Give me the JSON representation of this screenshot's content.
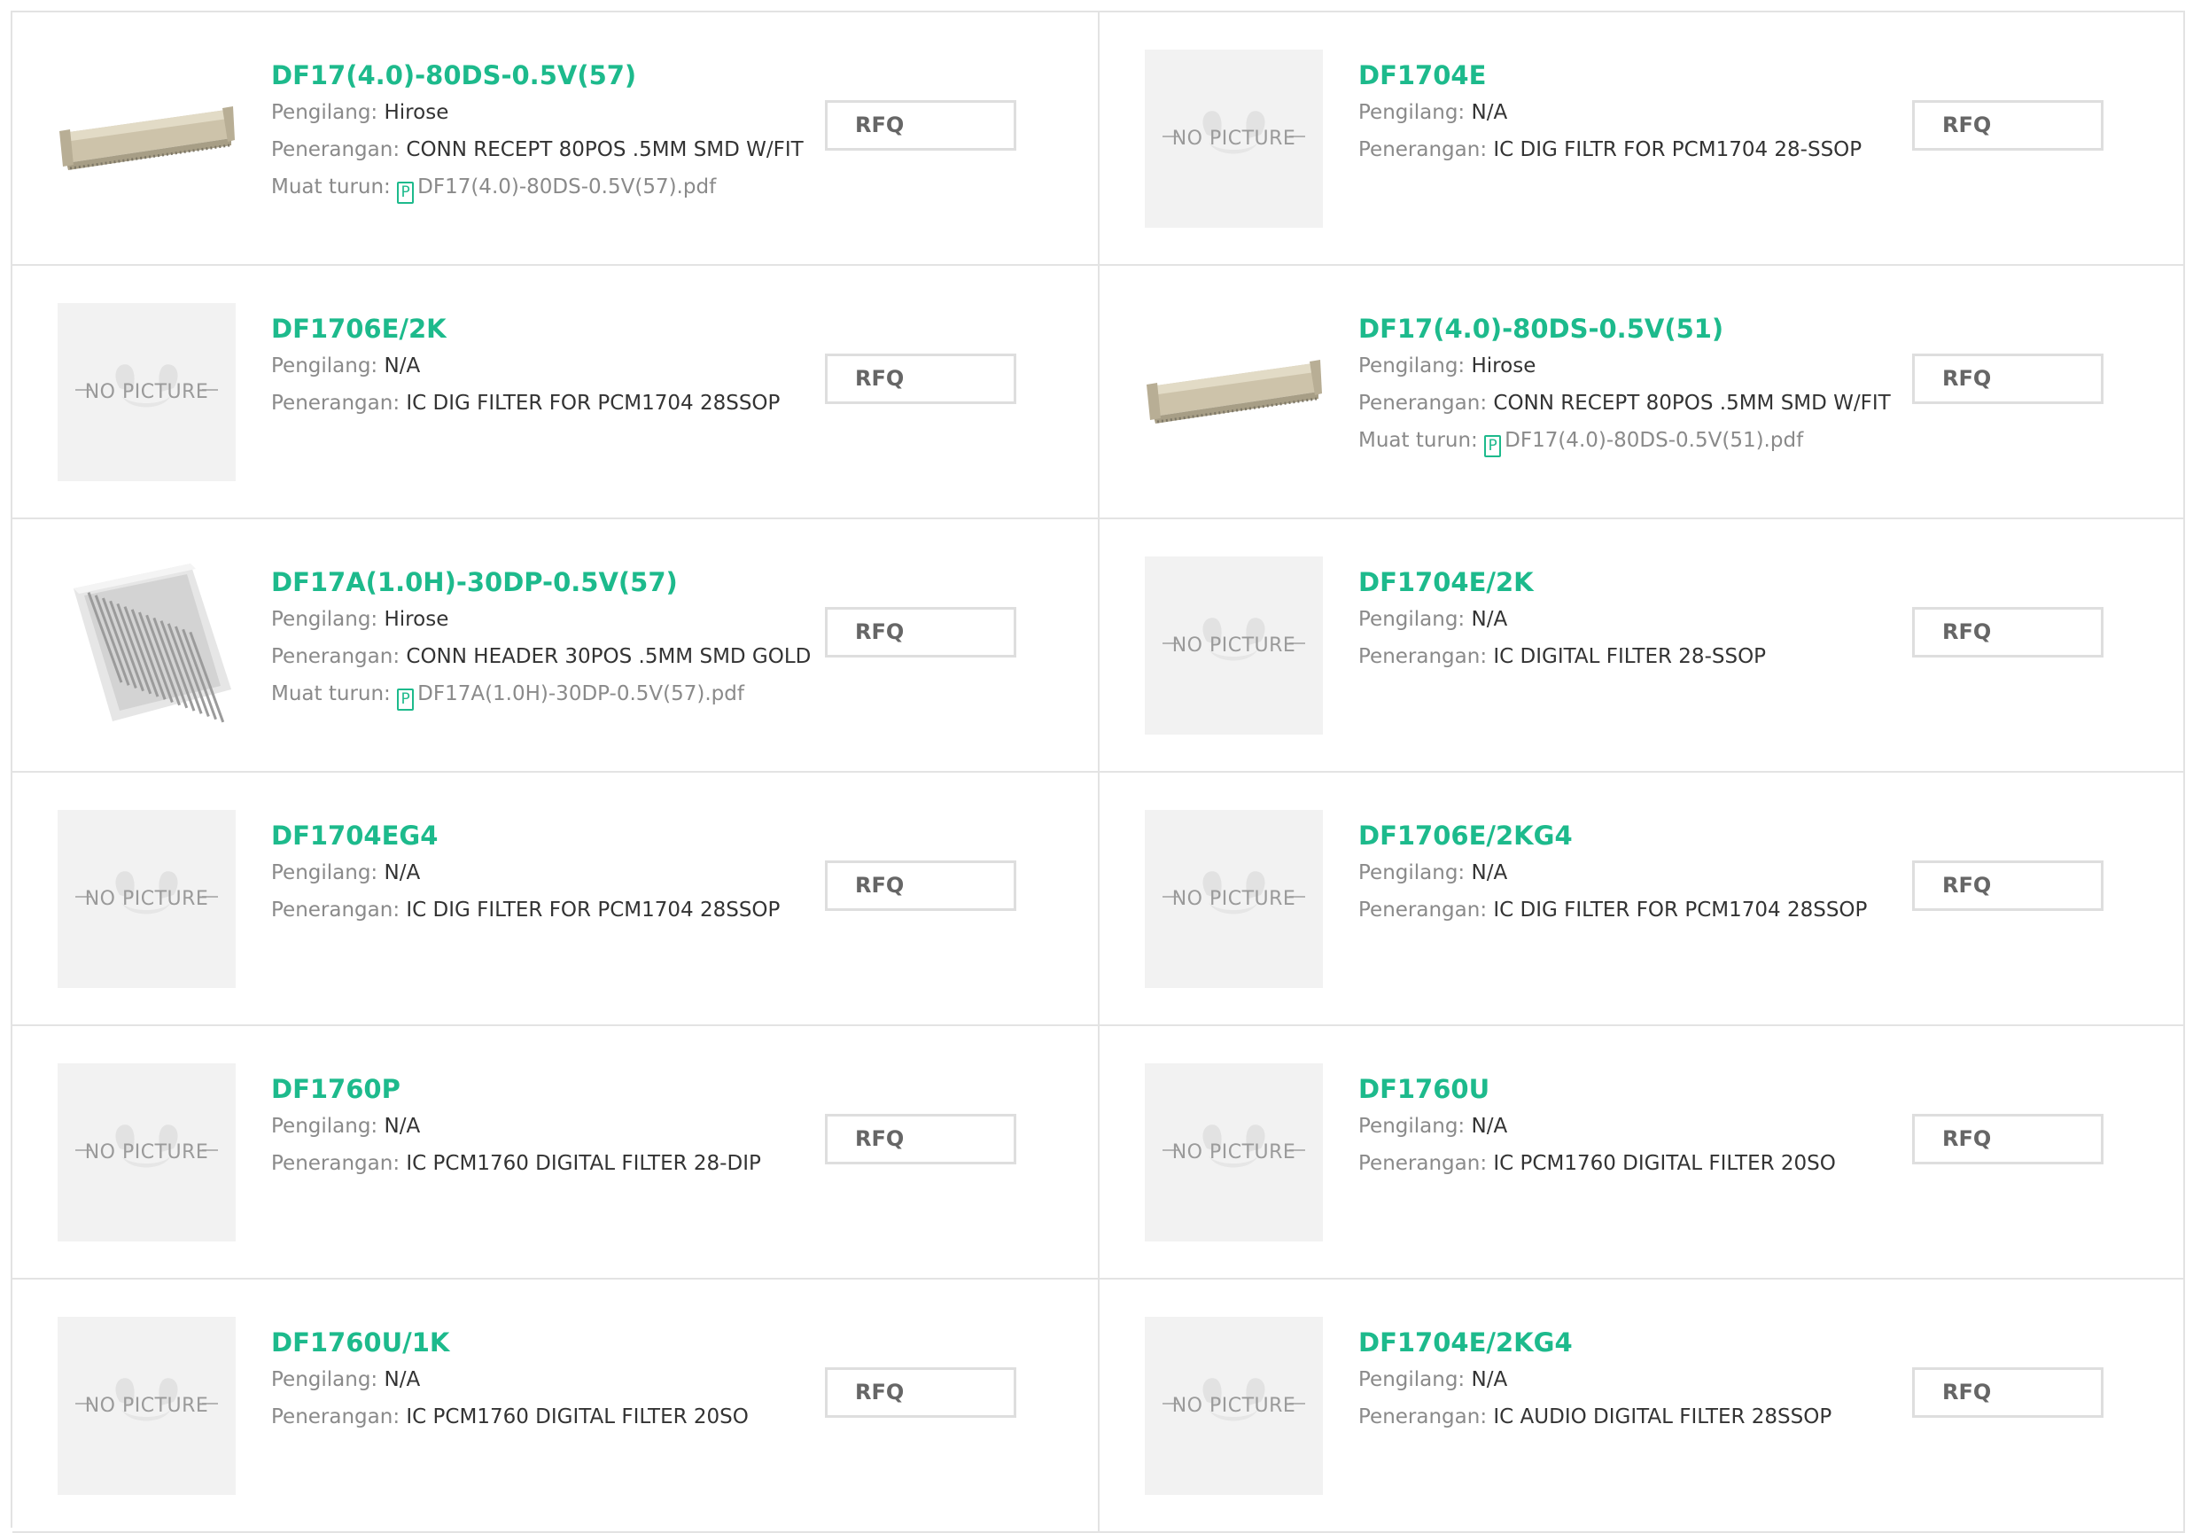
{
  "labels": {
    "manufacturer": "Pengilang: ",
    "description": "Penerangan: ",
    "download": "Muat turun: ",
    "rfq": "RFQ",
    "no_picture": "NO PICTURE",
    "pdf_icon": "P"
  },
  "parts": [
    {
      "title": "DF17(4.0)-80DS-0.5V(57)",
      "manufacturer": "Hirose",
      "description": "CONN RECEPT 80POS .5MM SMD W/FIT",
      "download": "DF17(4.0)-80DS-0.5V(57).pdf",
      "image": "connector-receptacle"
    },
    {
      "title": "DF1704E",
      "manufacturer": "N/A",
      "description": "IC DIG FILTR FOR PCM1704 28-SSOP",
      "download": null,
      "image": "no-picture"
    },
    {
      "title": "DF1706E/2K",
      "manufacturer": "N/A",
      "description": "IC DIG FILTER FOR PCM1704 28SSOP",
      "download": null,
      "image": "no-picture"
    },
    {
      "title": "DF17(4.0)-80DS-0.5V(51)",
      "manufacturer": "Hirose",
      "description": "CONN RECEPT 80POS .5MM SMD W/FIT",
      "download": "DF17(4.0)-80DS-0.5V(51).pdf",
      "image": "connector-receptacle"
    },
    {
      "title": "DF17A(1.0H)-30DP-0.5V(57)",
      "manufacturer": "Hirose",
      "description": "CONN HEADER 30POS .5MM SMD GOLD",
      "download": "DF17A(1.0H)-30DP-0.5V(57).pdf",
      "image": "connector-header"
    },
    {
      "title": "DF1704E/2K",
      "manufacturer": "N/A",
      "description": "IC DIGITAL FILTER 28-SSOP",
      "download": null,
      "image": "no-picture"
    },
    {
      "title": "DF1704EG4",
      "manufacturer": "N/A",
      "description": "IC DIG FILTER FOR PCM1704 28SSOP",
      "download": null,
      "image": "no-picture"
    },
    {
      "title": "DF1706E/2KG4",
      "manufacturer": "N/A",
      "description": "IC DIG FILTER FOR PCM1704 28SSOP",
      "download": null,
      "image": "no-picture"
    },
    {
      "title": "DF1760P",
      "manufacturer": "N/A",
      "description": "IC PCM1760 DIGITAL FILTER 28-DIP",
      "download": null,
      "image": "no-picture"
    },
    {
      "title": "DF1760U",
      "manufacturer": "N/A",
      "description": "IC PCM1760 DIGITAL FILTER 20SO",
      "download": null,
      "image": "no-picture"
    },
    {
      "title": "DF1760U/1K",
      "manufacturer": "N/A",
      "description": "IC PCM1760 DIGITAL FILTER 20SO",
      "download": null,
      "image": "no-picture"
    },
    {
      "title": "DF1704E/2KG4",
      "manufacturer": "N/A",
      "description": "IC AUDIO DIGITAL FILTER 28SSOP",
      "download": null,
      "image": "no-picture"
    }
  ],
  "colors": {
    "accent": "#1dba8c",
    "border": "#e3e3e3",
    "label": "#8a8a8a",
    "value": "#333333",
    "placeholder_bg": "#f2f2f2"
  }
}
